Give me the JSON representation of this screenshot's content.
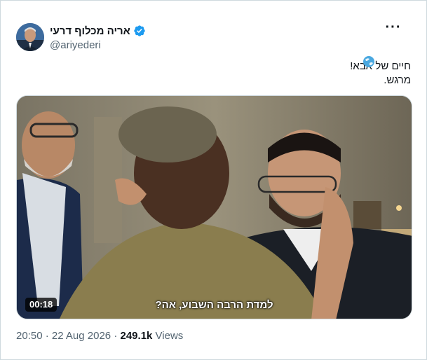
{
  "author": {
    "display_name": "אריה מכלוף דרעי",
    "handle": "@ariyederi",
    "verified": true
  },
  "tweet": {
    "line1": "חיים של אבא!",
    "line2": "מרגש."
  },
  "video": {
    "subtitle": "למדת הרבה השבוע, אה?",
    "duration": "00:18"
  },
  "meta": {
    "time": "20:50",
    "separator": " · ",
    "date": "22 Aug 2026",
    "views_count": "249.1k",
    "views_label": " Views"
  },
  "icons": {
    "verified": "verified-badge-icon",
    "more": "more-options-icon",
    "globe": "globe-emoji-icon"
  },
  "colors": {
    "verified_blue": "#1d9bf0",
    "secondary_text": "#536471",
    "border": "#cfd9de"
  }
}
